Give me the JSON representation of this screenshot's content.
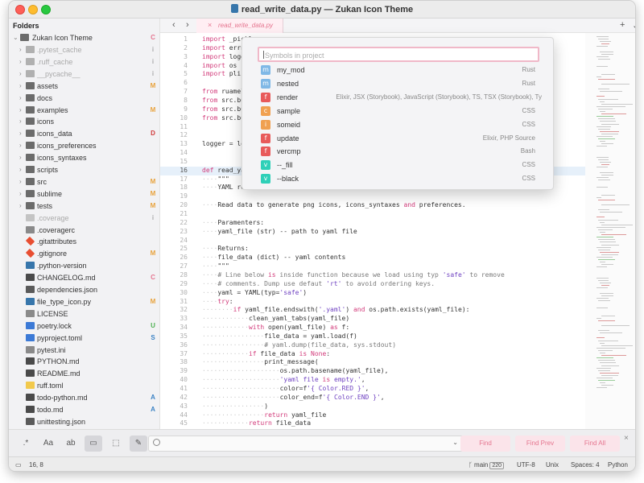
{
  "window": {
    "title": "read_write_data.py — Zukan Icon Theme"
  },
  "sidebar": {
    "header": "Folders",
    "root": {
      "label": "Zukan Icon Theme",
      "badge": "C"
    },
    "items": [
      {
        "label": ".pytest_cache",
        "badge": "i",
        "kind": "folder",
        "dim": true,
        "chevron": true
      },
      {
        "label": ".ruff_cache",
        "badge": "i",
        "kind": "folder",
        "dim": true,
        "chevron": true
      },
      {
        "label": "__pycache__",
        "badge": "i",
        "kind": "folder",
        "dim": true,
        "chevron": true
      },
      {
        "label": "assets",
        "badge": "M",
        "kind": "folder",
        "dim": false,
        "chevron": true
      },
      {
        "label": "docs",
        "badge": "",
        "kind": "folder",
        "dim": false,
        "chevron": true
      },
      {
        "label": "examples",
        "badge": "M",
        "kind": "folder",
        "dim": false,
        "chevron": true
      },
      {
        "label": "icons",
        "badge": "",
        "kind": "folder",
        "dim": false,
        "chevron": true
      },
      {
        "label": "icons_data",
        "badge": "D",
        "kind": "folder",
        "dim": false,
        "chevron": true
      },
      {
        "label": "icons_preferences",
        "badge": "",
        "kind": "folder",
        "dim": false,
        "chevron": true
      },
      {
        "label": "icons_syntaxes",
        "badge": "",
        "kind": "folder",
        "dim": false,
        "chevron": true
      },
      {
        "label": "scripts",
        "badge": "",
        "kind": "folder",
        "dim": false,
        "chevron": true
      },
      {
        "label": "src",
        "badge": "M",
        "kind": "folder",
        "dim": false,
        "chevron": true
      },
      {
        "label": "sublime",
        "badge": "M",
        "kind": "folder",
        "dim": false,
        "chevron": true
      },
      {
        "label": "tests",
        "badge": "M",
        "kind": "folder",
        "dim": false,
        "chevron": true
      },
      {
        "label": ".coverage",
        "badge": "i",
        "kind": "file",
        "dim": true,
        "chevron": false
      },
      {
        "label": ".coveragerc",
        "badge": "",
        "kind": "file",
        "dim": false,
        "chevron": false
      },
      {
        "label": ".gitattributes",
        "badge": "",
        "kind": "git",
        "dim": false,
        "chevron": false
      },
      {
        "label": ".gitignore",
        "badge": "M",
        "kind": "git",
        "dim": false,
        "chevron": false
      },
      {
        "label": ".python-version",
        "badge": "",
        "kind": "py",
        "dim": false,
        "chevron": false
      },
      {
        "label": "CHANGELOG.md",
        "badge": "C",
        "kind": "md",
        "dim": false,
        "chevron": false
      },
      {
        "label": "dependencies.json",
        "badge": "",
        "kind": "json",
        "dim": false,
        "chevron": false
      },
      {
        "label": "file_type_icon.py",
        "badge": "M",
        "kind": "py",
        "dim": false,
        "chevron": false
      },
      {
        "label": "LICENSE",
        "badge": "",
        "kind": "file",
        "dim": false,
        "chevron": false
      },
      {
        "label": "poetry.lock",
        "badge": "U",
        "kind": "poetry",
        "dim": false,
        "chevron": false
      },
      {
        "label": "pyproject.toml",
        "badge": "S",
        "kind": "poetry",
        "dim": false,
        "chevron": false
      },
      {
        "label": "pytest.ini",
        "badge": "",
        "kind": "file",
        "dim": false,
        "chevron": false
      },
      {
        "label": "PYTHON.md",
        "badge": "",
        "kind": "md",
        "dim": false,
        "chevron": false
      },
      {
        "label": "README.md",
        "badge": "",
        "kind": "md",
        "dim": false,
        "chevron": false
      },
      {
        "label": "ruff.toml",
        "badge": "",
        "kind": "ruff",
        "dim": false,
        "chevron": false
      },
      {
        "label": "todo-python.md",
        "badge": "A",
        "kind": "md",
        "dim": false,
        "chevron": false
      },
      {
        "label": "todo.md",
        "badge": "A",
        "kind": "md",
        "dim": false,
        "chevron": false
      },
      {
        "label": "unittesting.json",
        "badge": "",
        "kind": "json",
        "dim": false,
        "chevron": false
      }
    ],
    "badge_colors": {
      "C": "#e5758f",
      "M": "#e8a33d",
      "D": "#d03a3a",
      "U": "#4caf50",
      "S": "#3b82c4",
      "A": "#3b82c4",
      "i": "#aaaaaa"
    }
  },
  "tabbar": {
    "back_icon": "‹",
    "forward_icon": "›",
    "tab_close_icon": "×",
    "tab_label": "read_write_data.py",
    "new_tab_icon": "+",
    "menu_icon": "⌄"
  },
  "editor": {
    "current_line": "16",
    "lines": [
      {
        "n": "1",
        "t": "import _pickl"
      },
      {
        "n": "2",
        "t": "import errno"
      },
      {
        "n": "3",
        "t": "import loggin"
      },
      {
        "n": "4",
        "t": "import os"
      },
      {
        "n": "5",
        "t": "import plistl"
      },
      {
        "n": "6",
        "t": ""
      },
      {
        "n": "7",
        "t": "from ruamel.y"
      },
      {
        "n": "8",
        "t": "from src.buil"
      },
      {
        "n": "9",
        "t": "from src.buil"
      },
      {
        "n": "10",
        "t": "from src.buil"
      },
      {
        "n": "11",
        "t": ""
      },
      {
        "n": "12",
        "t": ""
      },
      {
        "n": "13",
        "t": "logger = logg"
      },
      {
        "n": "14",
        "t": ""
      },
      {
        "n": "15",
        "t": ""
      },
      {
        "n": "16",
        "t": "def read_yaml"
      },
      {
        "n": "17",
        "t": "····\"\"\""
      },
      {
        "n": "18",
        "t": "····YAML read"
      },
      {
        "n": "19",
        "t": ""
      },
      {
        "n": "20",
        "t": "····Read data to generate png icons, icons_syntaxes and preferences."
      },
      {
        "n": "21",
        "t": ""
      },
      {
        "n": "22",
        "t": "····Paramenters:"
      },
      {
        "n": "23",
        "t": "····yaml_file (str) -- path to yaml file"
      },
      {
        "n": "24",
        "t": ""
      },
      {
        "n": "25",
        "t": "····Returns:"
      },
      {
        "n": "26",
        "t": "····file_data (dict) -- yaml contents"
      },
      {
        "n": "27",
        "t": "····\"\"\""
      },
      {
        "n": "28",
        "t": "····# Line below is inside function because we load using typ 'safe' to remove"
      },
      {
        "n": "29",
        "t": "····# comments. Dump use defaut 'rt' to avoid ordering keys."
      },
      {
        "n": "30",
        "t": "····yaml = YAML(typ='safe')"
      },
      {
        "n": "31",
        "t": "····try:"
      },
      {
        "n": "32",
        "t": "········if yaml_file.endswith('.yaml') and os.path.exists(yaml_file):"
      },
      {
        "n": "33",
        "t": "············clean_yaml_tabs(yaml_file)"
      },
      {
        "n": "34",
        "t": "············with open(yaml_file) as f:"
      },
      {
        "n": "35",
        "t": "················file_data = yaml.load(f)"
      },
      {
        "n": "36",
        "t": "················# yaml.dump(file_data, sys.stdout)"
      },
      {
        "n": "37",
        "t": "············if file_data is None:"
      },
      {
        "n": "38",
        "t": "················print_message("
      },
      {
        "n": "39",
        "t": "····················os.path.basename(yaml_file),"
      },
      {
        "n": "40",
        "t": "····················'yaml file is empty.',"
      },
      {
        "n": "41",
        "t": "····················color=f'{ Color.RED }',"
      },
      {
        "n": "42",
        "t": "····················color_end=f'{ Color.END }',"
      },
      {
        "n": "43",
        "t": "················)"
      },
      {
        "n": "44",
        "t": "················return yaml_file"
      },
      {
        "n": "45",
        "t": "············return file_data"
      }
    ]
  },
  "palette": {
    "placeholder": "Symbols in project",
    "items": [
      {
        "badge": "m",
        "name": "my_mod",
        "type": "Rust",
        "color": "#7fb8e6"
      },
      {
        "badge": "m",
        "name": "nested",
        "type": "Rust",
        "color": "#7fb8e6"
      },
      {
        "badge": "f",
        "name": "render",
        "type": "Elixir, JSX (Storybook), JavaScript (Storybook), TS, TSX (Storybook), Ty",
        "color": "#e85a5a"
      },
      {
        "badge": "c",
        "name": "sample",
        "type": "CSS",
        "color": "#f0a050"
      },
      {
        "badge": "i",
        "name": "someid",
        "type": "CSS",
        "color": "#f0a050"
      },
      {
        "badge": "f",
        "name": "update",
        "type": "Elixir, PHP Source",
        "color": "#e85a5a"
      },
      {
        "badge": "f",
        "name": "vercmp",
        "type": "Bash",
        "color": "#e85a5a"
      },
      {
        "badge": "v",
        "name": "--_fill",
        "type": "CSS",
        "color": "#2fd0b8"
      },
      {
        "badge": "v",
        "name": "--black",
        "type": "CSS",
        "color": "#2fd0b8"
      }
    ]
  },
  "findbar": {
    "options": [
      {
        "label": ".*",
        "name": "regex-toggle",
        "active": false
      },
      {
        "label": "Aa",
        "name": "case-sensitive-toggle",
        "active": false
      },
      {
        "label": "ab",
        "name": "whole-word-toggle",
        "active": false
      },
      {
        "label": "▭",
        "name": "wrap-toggle",
        "active": true
      },
      {
        "label": "⬚",
        "name": "in-selection-toggle",
        "active": false
      },
      {
        "label": "✎",
        "name": "highlight-matches-toggle",
        "active": true
      }
    ],
    "dropdown_icon": "⌄",
    "find_label": "Find",
    "find_prev_label": "Find Prev",
    "find_all_label": "Find All",
    "close_icon": "×"
  },
  "statusbar": {
    "position": "16, 8",
    "branch": "main",
    "branch_count": "220",
    "encoding": "UTF-8",
    "line_endings": "Unix",
    "indent": "Spaces: 4",
    "syntax": "Python"
  }
}
